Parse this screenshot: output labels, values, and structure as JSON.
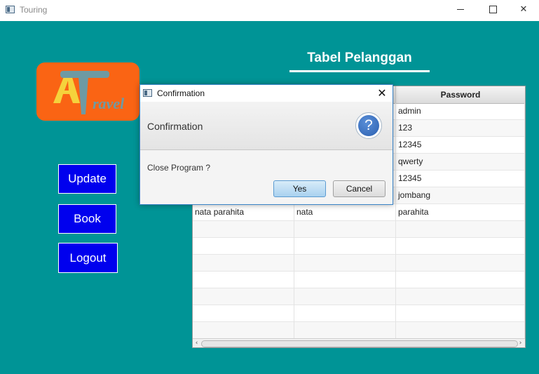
{
  "window": {
    "title": "Touring"
  },
  "sidebar": {
    "update_label": "Update",
    "book_label": "Book",
    "logout_label": "Logout"
  },
  "main": {
    "heading": "Tabel Pelanggan"
  },
  "table": {
    "columns": [
      "",
      "",
      "Password"
    ],
    "rows": [
      [
        "",
        "",
        "admin"
      ],
      [
        "",
        "",
        "123"
      ],
      [
        "",
        "",
        "12345"
      ],
      [
        "",
        "",
        "qwerty"
      ],
      [
        "",
        "",
        "12345"
      ],
      [
        "",
        "",
        "jombang"
      ],
      [
        "nata parahita",
        "nata",
        "parahita"
      ]
    ]
  },
  "dialog": {
    "title": "Confirmation",
    "header": "Confirmation",
    "message": "Close Program ?",
    "yes_label": "Yes",
    "cancel_label": "Cancel",
    "icon": "question-icon"
  },
  "colors": {
    "background": "#009496",
    "logo_bg": "#fa6414",
    "nav_button": "#0000ee"
  }
}
